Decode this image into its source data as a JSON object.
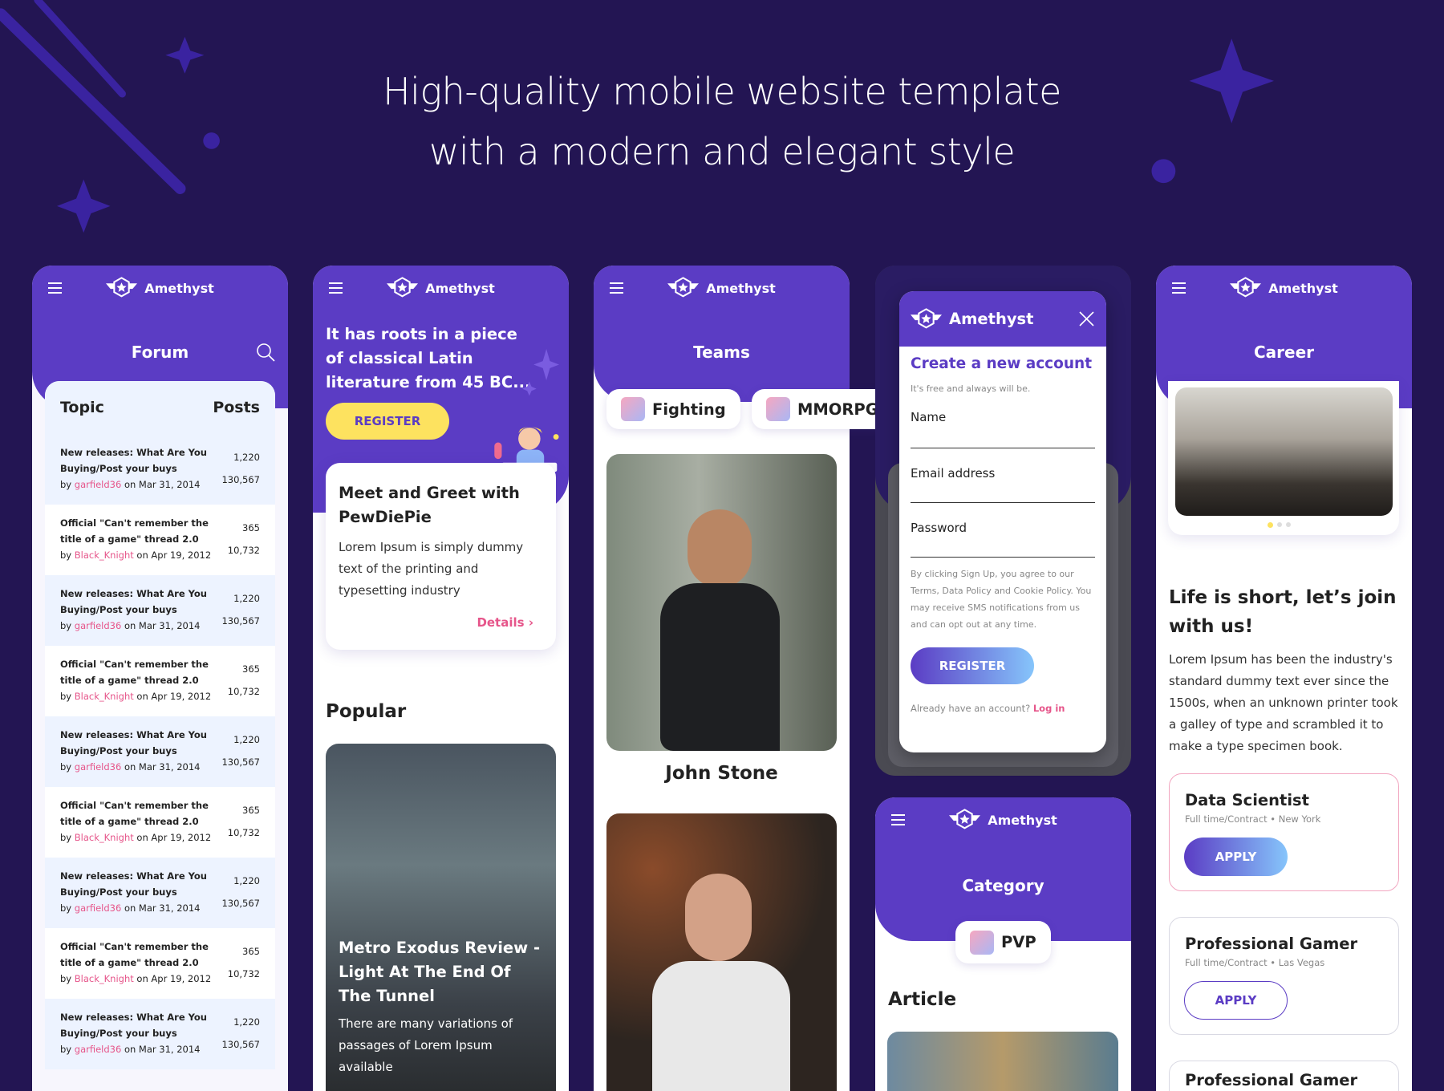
{
  "hero": {
    "line1": "High-quality mobile website template",
    "line2": "with a modern and elegant style"
  },
  "brand": "Amethyst",
  "colors": {
    "primary": "#5b3cc4",
    "background": "#231553",
    "accent_pink": "#e6558a",
    "button_yellow": "#fde25f"
  },
  "forum": {
    "title": "Forum",
    "col_topic": "Topic",
    "col_posts": "Posts",
    "rows": [
      {
        "title": "New releases: What Are You Buying/Post your buys",
        "by": "by",
        "user": "garfield36",
        "date": "on Mar 31, 2014",
        "n1": "1,220",
        "n2": "130,567"
      },
      {
        "title": "Official \"Can't remember the title of a game\" thread 2.0",
        "by": "by",
        "user": "Black_Knight",
        "date": "on Apr 19, 2012",
        "n1": "365",
        "n2": "10,732"
      },
      {
        "title": "New releases: What Are You Buying/Post your buys",
        "by": "by",
        "user": "garfield36",
        "date": "on Mar 31, 2014",
        "n1": "1,220",
        "n2": "130,567"
      },
      {
        "title": "Official \"Can't remember the title of a game\" thread 2.0",
        "by": "by",
        "user": "Black_Knight",
        "date": "on Apr 19, 2012",
        "n1": "365",
        "n2": "10,732"
      },
      {
        "title": "New releases: What Are You Buying/Post your buys",
        "by": "by",
        "user": "garfield36",
        "date": "on Mar 31, 2014",
        "n1": "1,220",
        "n2": "130,567"
      },
      {
        "title": "Official \"Can't remember the title of a game\" thread 2.0",
        "by": "by",
        "user": "Black_Knight",
        "date": "on Apr 19, 2012",
        "n1": "365",
        "n2": "10,732"
      },
      {
        "title": "New releases: What Are You Buying/Post your buys",
        "by": "by",
        "user": "garfield36",
        "date": "on Mar 31, 2014",
        "n1": "1,220",
        "n2": "130,567"
      },
      {
        "title": "Official \"Can't remember the title of a game\" thread 2.0",
        "by": "by",
        "user": "Black_Knight",
        "date": "on Apr 19, 2012",
        "n1": "365",
        "n2": "10,732"
      },
      {
        "title": "New releases: What Are You Buying/Post your buys",
        "by": "by",
        "user": "garfield36",
        "date": "on Mar 31, 2014",
        "n1": "1,220",
        "n2": "130,567"
      }
    ]
  },
  "home": {
    "headline": "It has roots in a piece of classical Latin literature from 45 BC...",
    "register": "REGISTER",
    "card_title": "Meet and Greet with PewDiePie",
    "card_text": "Lorem Ipsum is simply dummy text of the printing and typesetting industry",
    "details": "Details",
    "popular": "Popular",
    "article_title": "Metro Exodus Review - Light At The End Of The Tunnel",
    "article_text": "There are many variations of passages of Lorem Ipsum available"
  },
  "teams": {
    "title": "Teams",
    "tabs": [
      "Fighting",
      "MMORPG"
    ],
    "member1": "John Stone"
  },
  "signup": {
    "title": "Create a new account",
    "subtitle": "It's free and always will be.",
    "name": "Name",
    "email": "Email address",
    "password": "Password",
    "terms": "By clicking Sign Up, you agree to our Terms, Data Policy and Cookie Policy. You may receive SMS notifications from us and can opt out at any time.",
    "register": "REGISTER",
    "already": "Already have an account?",
    "login": "Log in"
  },
  "category": {
    "title": "Category",
    "pill": "PVP",
    "section": "Article"
  },
  "career": {
    "title": "Career",
    "headline": "Life is short, let’s join with us!",
    "text": "Lorem Ipsum has been the industry's standard dummy text ever since the 1500s, when an unknown printer took a galley of type and scrambled it to make a type specimen book.",
    "jobs": [
      {
        "title": "Data Scientist",
        "meta": "Full time/Contract • New York",
        "apply": "APPLY"
      },
      {
        "title": "Professional Gamer",
        "meta": "Full time/Contract • Las Vegas",
        "apply": "APPLY"
      },
      {
        "title": "Professional Gamer"
      }
    ]
  }
}
